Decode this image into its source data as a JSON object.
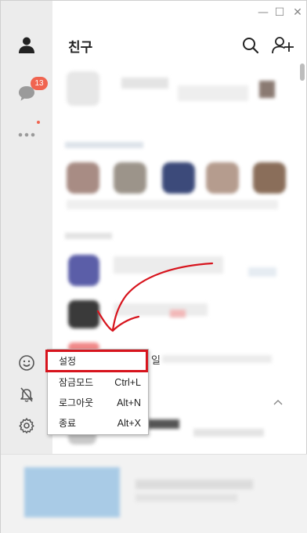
{
  "window": {
    "controls": {
      "minimize": "—",
      "maximize": "☐",
      "close": "✕"
    }
  },
  "sidebar": {
    "items": [
      {
        "name": "friends",
        "icon": "person-icon"
      },
      {
        "name": "chats",
        "icon": "chat-bubble-icon",
        "badge": "13"
      },
      {
        "name": "more",
        "icon": "more-dots-icon"
      }
    ],
    "bottom": [
      {
        "name": "emoticon",
        "icon": "smiley-icon"
      },
      {
        "name": "notifications",
        "icon": "bell-off-icon"
      },
      {
        "name": "settings",
        "icon": "gear-icon"
      }
    ]
  },
  "header": {
    "title": "친구",
    "search_icon": "search-icon",
    "add_friend_icon": "add-friend-icon"
  },
  "partial_text": "일",
  "context_menu": {
    "items": [
      {
        "label": "설정",
        "shortcut": ""
      },
      {
        "label": "잠금모드",
        "shortcut": "Ctrl+L"
      },
      {
        "label": "로그아웃",
        "shortcut": "Alt+N"
      },
      {
        "label": "종료",
        "shortcut": "Alt+X"
      }
    ]
  },
  "colors": {
    "badge": "#f06450",
    "annotation": "#d7141d",
    "sidebar": "#ececec"
  }
}
